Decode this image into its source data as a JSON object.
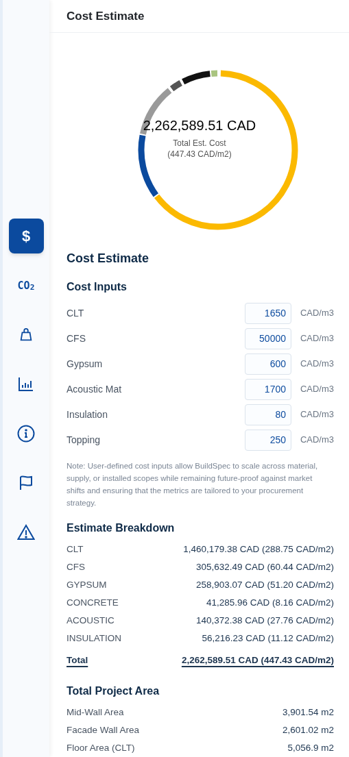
{
  "sidebar": {
    "items": [
      {
        "kind": "dollar",
        "label": "$",
        "selected": true
      },
      {
        "kind": "co2",
        "label": "CO$_{2}$",
        "selected": false
      },
      {
        "kind": "bag",
        "selected": false
      },
      {
        "kind": "chart",
        "selected": false
      },
      {
        "kind": "info",
        "selected": false
      },
      {
        "kind": "flag",
        "selected": false
      },
      {
        "kind": "warning",
        "selected": false
      }
    ]
  },
  "header": {
    "title": "Cost Estimate"
  },
  "summary": {
    "total": "2,262,589.51 CAD",
    "caption": "Total Est. Cost",
    "per_area": "(447.43 CAD/m2)"
  },
  "section_title": "Cost Estimate",
  "cost_inputs": {
    "title": "Cost Inputs",
    "rows": [
      {
        "label": "CLT",
        "value": "1650",
        "unit": "CAD/m3"
      },
      {
        "label": "CFS",
        "value": "50000",
        "unit": "CAD/m3"
      },
      {
        "label": "Gypsum",
        "value": "600",
        "unit": "CAD/m3"
      },
      {
        "label": "Acoustic Mat",
        "value": "1700",
        "unit": "CAD/m3"
      },
      {
        "label": "Insulation",
        "value": "80",
        "unit": "CAD/m3"
      },
      {
        "label": "Topping",
        "value": "250",
        "unit": "CAD/m3"
      }
    ],
    "note": "Note: User-defined cost inputs allow BuildSpec to scale across material, supply, or installed scopes while remaining future-proof against market shifts and ensuring that the metrics are tailored to your procurement strategy."
  },
  "breakdown": {
    "title": "Estimate Breakdown",
    "rows": [
      {
        "label": "CLT",
        "value": "1,460,179.38 CAD (288.75 CAD/m2)"
      },
      {
        "label": "CFS",
        "value": "305,632.49 CAD (60.44 CAD/m2)"
      },
      {
        "label": "GYPSUM",
        "value": "258,903.07 CAD (51.20 CAD/m2)"
      },
      {
        "label": "CONCRETE",
        "value": "41,285.96 CAD (8.16 CAD/m2)"
      },
      {
        "label": "ACOUSTIC",
        "value": "140,372.38 CAD (27.76 CAD/m2)"
      },
      {
        "label": "INSULATION",
        "value": "56,216.23 CAD (11.12 CAD/m2)"
      }
    ],
    "total": {
      "label": "Total",
      "value": "2,262,589.51 CAD (447.43 CAD/m2)"
    }
  },
  "area": {
    "title": "Total Project Area",
    "rows": [
      {
        "label": "Mid-Wall Area",
        "value": "3,901.54 m2"
      },
      {
        "label": "Facade Wall Area",
        "value": "2,601.02 m2"
      },
      {
        "label": "Floor Area (CLT)",
        "value": "5,056.9 m2"
      }
    ]
  }
}
